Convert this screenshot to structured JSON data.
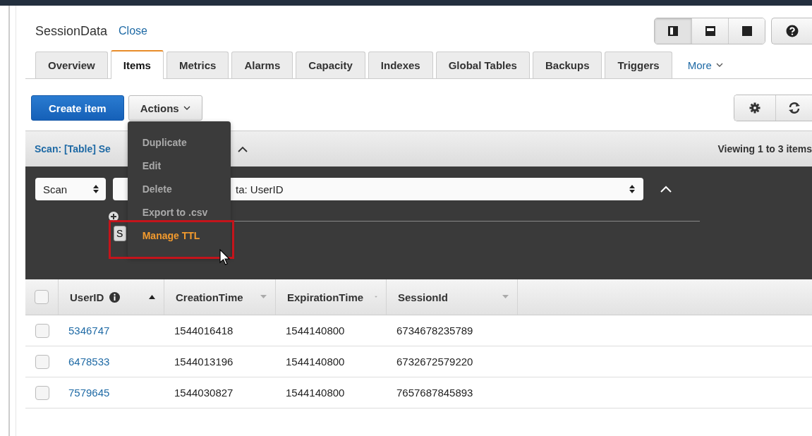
{
  "title": "SessionData",
  "close_link": "Close",
  "view_buttons": [
    {
      "kind": "split-right",
      "selected": true
    },
    {
      "kind": "split-bottom",
      "selected": false
    },
    {
      "kind": "full",
      "selected": false
    }
  ],
  "tabs": [
    {
      "label": "Overview",
      "selected": false
    },
    {
      "label": "Items",
      "selected": true
    },
    {
      "label": "Metrics",
      "selected": false
    },
    {
      "label": "Alarms",
      "selected": false
    },
    {
      "label": "Capacity",
      "selected": false
    },
    {
      "label": "Indexes",
      "selected": false
    },
    {
      "label": "Global Tables",
      "selected": false
    },
    {
      "label": "Backups",
      "selected": false
    },
    {
      "label": "Triggers",
      "selected": false
    }
  ],
  "more_tab": "More",
  "create_button": "Create item",
  "actions_button": "Actions",
  "actions_menu": [
    {
      "label": "Duplicate",
      "highlighted": false
    },
    {
      "label": "Edit",
      "highlighted": false
    },
    {
      "label": "Delete",
      "highlighted": false
    },
    {
      "label": "Export to .csv",
      "highlighted": false
    },
    {
      "label": "Manage TTL",
      "highlighted": true
    }
  ],
  "scan_header": {
    "title": "Scan: [Table] Se",
    "status": "Viewing 1 to 3 items"
  },
  "query": {
    "mode": "Scan",
    "source": "ta: UserID",
    "start_button": "S"
  },
  "table": {
    "all_checked": false,
    "columns": [
      {
        "label": "UserID",
        "info": true,
        "sorted": true
      },
      {
        "label": "CreationTime",
        "info": false,
        "sorted": false
      },
      {
        "label": "ExpirationTime",
        "info": false,
        "sorted": false
      },
      {
        "label": "SessionId",
        "info": false,
        "sorted": false
      }
    ],
    "rows": [
      {
        "checked": false,
        "cells": [
          "5346747",
          "1544016418",
          "1544140800",
          "6734678235789"
        ]
      },
      {
        "checked": false,
        "cells": [
          "6478533",
          "1544013196",
          "1544140800",
          "6732672579220"
        ]
      },
      {
        "checked": false,
        "cells": [
          "7579645",
          "1544030827",
          "1544140800",
          "7657687845893"
        ]
      }
    ]
  }
}
